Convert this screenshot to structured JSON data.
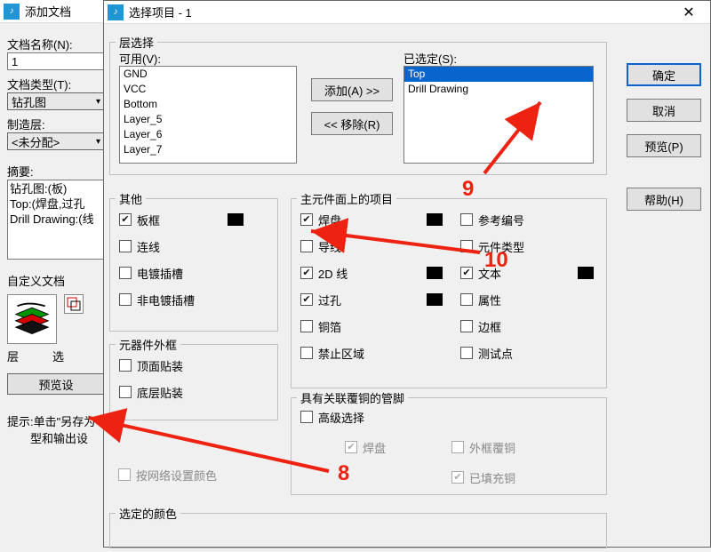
{
  "bg": {
    "title": "添加文档",
    "doc_name_label": "文档名称(N):",
    "doc_name_value": "1",
    "doc_type_label": "文档类型(T):",
    "doc_type_value": "钻孔图",
    "mfg_layer_label": "制造层:",
    "mfg_layer_value": "<未分配>",
    "summary_label": "摘要:",
    "summary_lines": [
      "钻孔图:(板)",
      "Top:(焊盘,过孔",
      "Drill Drawing:(线"
    ],
    "custom_doc_label": "自定义文档",
    "layer_cap": "层",
    "select_cap": "选",
    "preview_btn": "预览设",
    "tip_line1": "提示:单击\"另存为",
    "tip_line2": "　　型和输出设"
  },
  "fg": {
    "title": "选择项目 - 1",
    "buttons": {
      "ok": "确定",
      "cancel": "取消",
      "preview": "预览(P)",
      "help": "帮助(H)"
    },
    "layer_group": "层选择",
    "available_label": "可用(V):",
    "available": [
      "GND",
      "VCC",
      "Bottom",
      "Layer_5",
      "Layer_6",
      "Layer_7"
    ],
    "add_btn": "添加(A) >>",
    "remove_btn": "<< 移除(R)",
    "selected_label": "已选定(S):",
    "selected": [
      "Top",
      "Drill Drawing"
    ],
    "other_group": "其他",
    "other_items": [
      {
        "label": "板框",
        "checked": true,
        "swatch": true
      },
      {
        "label": "连线",
        "checked": false
      },
      {
        "label": "电镀插槽",
        "checked": false
      },
      {
        "label": "非电镀插槽",
        "checked": false
      }
    ],
    "comp_outline_group": "元器件外框",
    "comp_outline_items": [
      {
        "label": "顶面贴装",
        "checked": false
      },
      {
        "label": "底层贴装",
        "checked": false
      }
    ],
    "net_color_chk": "按网络设置颜色",
    "main_group": "主元件面上的项目",
    "main_left": [
      {
        "label": "焊盘",
        "checked": true,
        "swatch": true
      },
      {
        "label": "导线",
        "checked": false
      },
      {
        "label": "2D 线",
        "checked": true,
        "swatch": true
      },
      {
        "label": "过孔",
        "checked": true,
        "swatch": true
      },
      {
        "label": "铜箔",
        "checked": false
      },
      {
        "label": "禁止区域",
        "checked": false
      }
    ],
    "main_right": [
      {
        "label": "参考编号",
        "checked": false
      },
      {
        "label": "元件类型",
        "checked": false
      },
      {
        "label": "文本",
        "checked": true,
        "swatch": true
      },
      {
        "label": "属性",
        "checked": false
      },
      {
        "label": "边框",
        "checked": false
      },
      {
        "label": "测试点",
        "checked": false
      }
    ],
    "assoc_group": "具有关联覆铜的管脚",
    "adv_sel": "高级选择",
    "assoc_items": [
      {
        "label": "焊盘"
      },
      {
        "label": "外框覆铜"
      },
      {
        "label": "已填充铜"
      }
    ],
    "sel_color_group": "选定的颜色"
  },
  "anno": {
    "n8": "8",
    "n9": "9",
    "n10": "10"
  }
}
